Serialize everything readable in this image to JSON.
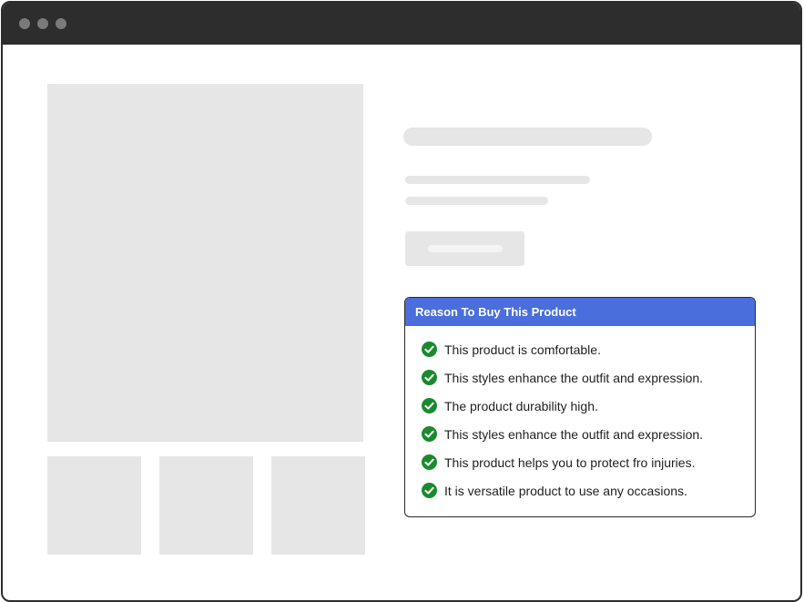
{
  "window": {
    "controls": [
      "window-dot-1",
      "window-dot-2",
      "window-dot-3"
    ]
  },
  "reasons": {
    "title": "Reason To Buy This Product",
    "items": [
      {
        "icon": "check-circle-icon",
        "text": "This product is comfortable."
      },
      {
        "icon": "check-circle-icon",
        "text": "This styles enhance the outfit and expression."
      },
      {
        "icon": "check-circle-icon",
        "text": "The product durability high."
      },
      {
        "icon": "check-circle-icon",
        "text": "This styles enhance the outfit and expression."
      },
      {
        "icon": "check-circle-icon",
        "text": "This product helps you to protect fro injuries."
      },
      {
        "icon": "check-circle-icon",
        "text": "It is versatile product to use any occasions."
      }
    ]
  },
  "colors": {
    "titlebar": "#2d2d2d",
    "header_accent": "#4a6edb",
    "check_green": "#1a8a2e",
    "placeholder": "#e6e6e6"
  }
}
